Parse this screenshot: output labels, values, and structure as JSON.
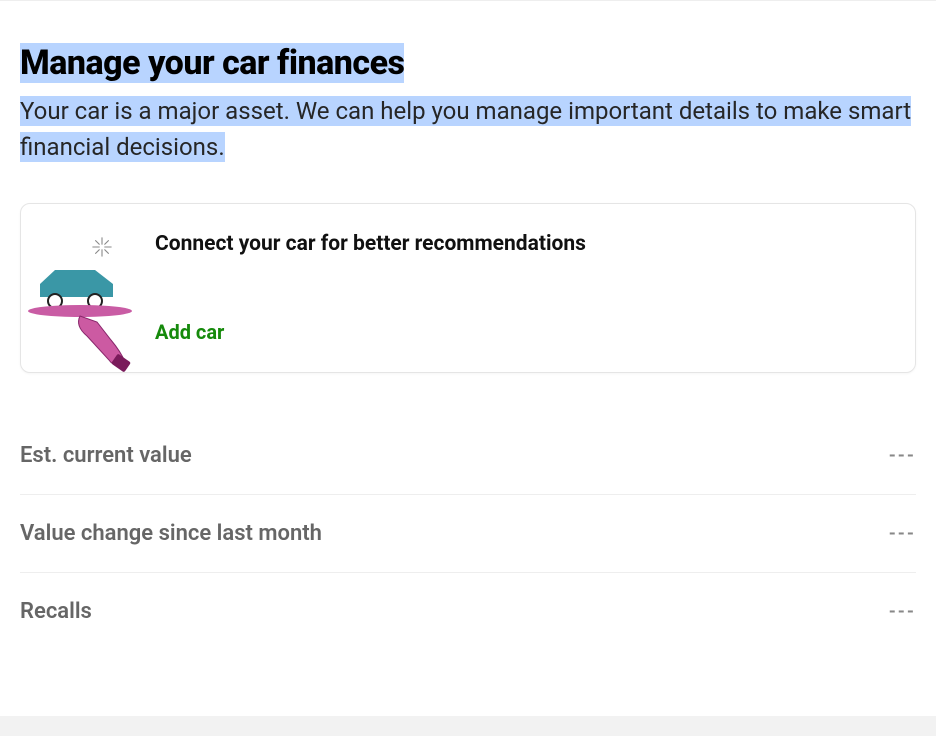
{
  "hero": {
    "title": "Manage your car finances",
    "subtitle": "Your car is a major asset. We can help you manage important details to make smart financial decisions."
  },
  "card": {
    "title": "Connect your car for better recommendations",
    "action_label": "Add car"
  },
  "stats": [
    {
      "label": "Est. current value",
      "value": "---"
    },
    {
      "label": "Value change since last month",
      "value": "---"
    },
    {
      "label": "Recalls",
      "value": "---"
    }
  ]
}
